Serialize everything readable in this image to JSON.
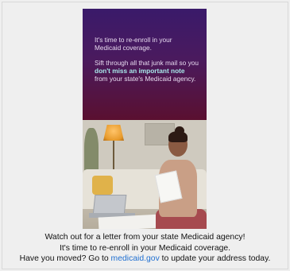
{
  "promo": {
    "line1": "It's time to re-enroll in your Medicaid coverage.",
    "line2_before": "Sift through all that junk mail so you ",
    "line2_highlight": "don't miss an important note",
    "line2_after": " from your state's Medicaid agency."
  },
  "photo": {
    "description_icon": "woman-reading-letter-photo"
  },
  "caption": {
    "line1": "Watch out for a letter from your state Medicaid agency!",
    "line2": "It's time to re-enroll in your Medicaid coverage.",
    "line3_before": "Have you moved? Go to ",
    "line3_link": "medicaid.gov",
    "line3_after": " to update your address today."
  },
  "colors": {
    "promo_gradient_top": "#3a1a6a",
    "promo_gradient_bottom": "#5a1030",
    "highlight": "#a8e9ea",
    "link": "#1f6fd1"
  }
}
